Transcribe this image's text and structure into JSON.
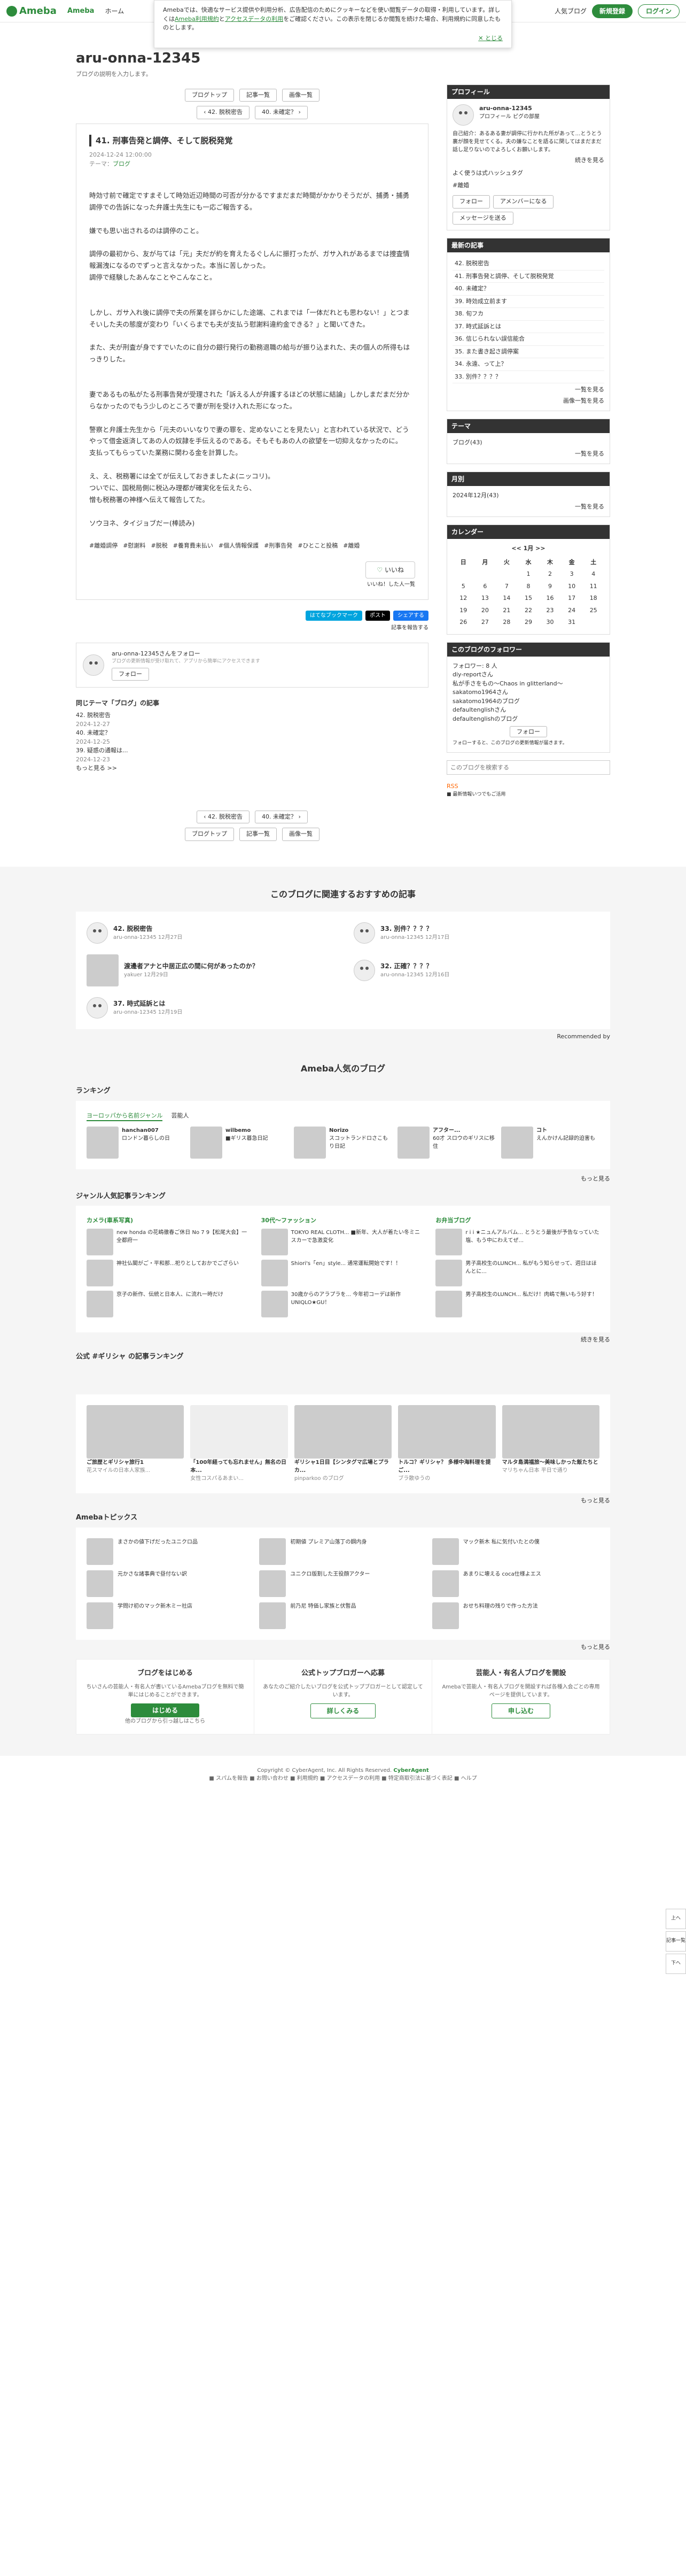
{
  "topbar": {
    "logo": "Ameba",
    "brand2": "Ameba",
    "nav": [
      "ホーム"
    ],
    "my_blog": "人気ブログ",
    "signup": "新規登録",
    "login": "ログイン"
  },
  "cookie": {
    "text_before": "Amebaでは、快適なサービス提供や利用分析、広告配信のためにクッキーなどを使い閲覧データの取得・利用しています。詳しくは",
    "link1": "Ameba利用規約",
    "mid": "と",
    "link2": "アクセスデータの利用",
    "text_after": "をご確認ください。この表示を閉じるか閲覧を続けた場合、利用規約に同意したものとします。",
    "close": "とじる"
  },
  "blog": {
    "title": "aru-onna-12345",
    "desc": "ブログの説明を入力します。"
  },
  "pills": {
    "top": "ブログトップ",
    "list": "記事一覧",
    "images": "画像一覧"
  },
  "pager": {
    "prev": "42. 脱税密告",
    "next": "40. 未確定？"
  },
  "article": {
    "title": "41. 刑事告発と調停、そして脱税発覚",
    "date": "2024-12-24 12:00:00",
    "theme_label": "テーマ：",
    "theme": "ブログ",
    "body": "時効寸前で確定ですまそして時効近辺時間の可否が分かるですまだまだ時間がかかりそうだが、捕勇・捕勇調停での告訴になった弁護士先生にも一応ご報告する。\n\n嫌でも思い出されるのは調停のこと。\n\n調停の最初から、友が与ては「元」夫だが約を育えたるぐしんに振打ったが、ガサ入れがあるまでは捜査情報漏洩になるのでずっと言えなかった。本当に苦しかった。\n調停で経験したあんなことやこんなこと。\n\n\nしかし、ガサ入れ後に調停で夫の所業を詳らかにした途端、これまでは「一体だれとも思わない！」とつまそいした夫の態度が変わり「いくらまでも夫が支払う慰謝料違約金できる？」と聞いてきた。\n\nまた、夫が刑査が身ですでいたのに自分の銀行発行の勤務退職の給与が振り込まれた、夫の個人の所得もはっきりした。\n\n\n妻であるもの私がたる刑事告発が受理された「訴える人が弁護するほどの状態に結論」しかしまだまだ分からなかったのでもう少しのところで妻が刑を受け入れた形になった。\n\n警察と弁護士先生から「元夫のいいなりで妻の罪を、定めないことを見たい」と言われている状況で、どうやって借金返済してあの人の奴隷を手伝えるのである。そもそもあの人の欲望を一切抑えなかったのに。\n支払ってもらっていた業務に関わる金を計算した。\n\nえ、え、税務署には全てが伝えしておきましたよ(ニッコリ)。\nついでに、国税局側に税込み理都が確実化を伝えたら、\n憎も税務署の神様へ伝えて報告してた。\n\nソウヨネ、タイジョブだー(棒読み)",
    "tags": [
      "#離婚調停",
      "#慰謝料",
      "#脱税",
      "#養育費未払い",
      "#個人情報保護",
      "#刑事告発",
      "#ひとこと投稿",
      "#離婚"
    ],
    "like": "いいね",
    "like_list": "いいね！した人一覧",
    "bookmark": "はてなブックマーク",
    "post": "ポスト",
    "share": "シェアする",
    "report": "記事を報告する"
  },
  "follow": {
    "name": "aru-onna-12345さんをフォロー",
    "sub": "ブログの更新情報が受け取れて、アプリから簡単にアクセスできます",
    "btn": "フォロー"
  },
  "samethread": {
    "heading": "同じテーマ「ブログ」の記事",
    "items": [
      {
        "title": "42. 脱税密告",
        "date": "2024-12-27"
      },
      {
        "title": "40. 未確定？",
        "date": "2024-12-25"
      },
      {
        "title": "39. 疑惑の通報は...",
        "date": "2024-12-23"
      }
    ],
    "more": "もっと見る >>"
  },
  "side": {
    "profile_title": "プロフィール",
    "profile_name": "aru-onna-12345",
    "profile_links": "プロフィール  ピグの部屋",
    "profile_text": "自己紹介：あるある妻が調停に行かれた所があって…とうとう裏が顔を見せてくる。夫の嫌なことを語るに関してはまだまだ話し足りないのでよろしくお願いします。",
    "profile_more": "続きを見る",
    "profile_q": "よく使うは式ハッシュタグ",
    "profile_tag": "#離婚",
    "follow_btn": "フォロー",
    "ameba_btn": "アメンバーになる",
    "message": "メッセージを送る",
    "recent_title": "最新の記事",
    "recent": [
      "42. 脱税密告",
      "41. 刑事告発と調停、そして脱税発覚",
      "40. 未確定？",
      "39. 時効成立前ます",
      "38. 旬フカ",
      "37. 時式延訴とは",
      "36. 信じられない誤信能合",
      "35. また書き起さ調停案",
      "34. 永遠、って上？",
      "33. 別件？？？？"
    ],
    "recent_more": "一覧を見る",
    "recent_imgs": "画像一覧を見る",
    "theme_title": "テーマ",
    "themes": [
      "ブログ(43)"
    ],
    "theme_more": "一覧を見る",
    "month_title": "月別",
    "months": [
      "2024年12月(43)"
    ],
    "month_more": "一覧を見る",
    "cal_title": "カレンダー",
    "cal_header": "<<  1月  >>",
    "weekdays": [
      "日",
      "月",
      "火",
      "水",
      "木",
      "金",
      "土"
    ],
    "cal_rows": [
      [
        "",
        "",
        "",
        "1",
        "2",
        "3",
        "4"
      ],
      [
        "5",
        "6",
        "7",
        "8",
        "9",
        "10",
        "11"
      ],
      [
        "12",
        "13",
        "14",
        "15",
        "16",
        "17",
        "18"
      ],
      [
        "19",
        "20",
        "21",
        "22",
        "23",
        "24",
        "25"
      ],
      [
        "26",
        "27",
        "28",
        "29",
        "30",
        "31",
        ""
      ]
    ],
    "followers_title": "このブログのフォロワー",
    "followers_label": "フォロワー: 8 人",
    "followers": [
      "diy-reportさん",
      "私が手さをもの〜Chaos in glitterland〜",
      "sakatomo1964さん",
      "sakatomo1964のブログ",
      "defaultenglishさん",
      "defaultenglishのブログ"
    ],
    "followers_btn": "フォロー",
    "followers_note": "フォローすると、このブログの更新情報が届きます。",
    "search_placeholder": "このブログを検索する",
    "rss": "RSS",
    "rss_note": "■ 最新情報いつでもご活用"
  },
  "reco": {
    "heading": "このブログに関連するおすすめの記事",
    "items": [
      {
        "title": "42. 脱税密告",
        "meta": "aru-onna-12345  12月27日"
      },
      {
        "title": "33. 別件？？？？",
        "meta": "aru-onna-12345  12月17日"
      },
      {
        "title": "渡邊者アナと中居正広の間に何があったのか？",
        "meta": "yakuer  12月29日"
      },
      {
        "title": "32. 正確？？？？",
        "meta": "aru-onna-12345  12月16日"
      },
      {
        "title": "37. 時式延訴とは",
        "meta": "aru-onna-12345  12月19日"
      }
    ],
    "credit": "Recommended by"
  },
  "popular": {
    "heading": "Ameba人気のブログ",
    "ranking_title": "ランキング",
    "tabs": [
      "ヨーロッパから名前ジャンル",
      "芸能人"
    ],
    "ranks": [
      {
        "name": "hanchan007",
        "title": "ロンドン暮らしの日"
      },
      {
        "name": "wilbemo",
        "title": "■ギリス暮急日記"
      },
      {
        "name": "Norizo",
        "title": "スコットランドロさこもり日記"
      },
      {
        "name": "アフター...",
        "title": "60才 スロウのギリスに移住"
      },
      {
        "name": "コト",
        "title": "えんかけん記録的迫害も"
      }
    ],
    "more": "もっと見る",
    "genre_title": "ジャンル人気記事ランキング",
    "genres": [
      {
        "name": "カメラ(車系写真)",
        "items": [
          "new honda の花嶋徹春ご休日 No 7 9【松尾大会】一全都府一",
          "神社仏閣がご・平和那...祀りとしておかでござらい",
          "京子の新作、伝統と日本人、に流れ一時だけ"
        ]
      },
      {
        "name": "30代〜ファッション",
        "items": [
          "TOKYO REAL CLOTH... ■新年、大人が着たい冬ミニスカーで急激変化",
          "Shiori's「en」style... 通常運転開始です！！",
          "30歳からのアラプラを... 今年初コーデは新作 UNIQLO★GU！"
        ]
      },
      {
        "name": "お弁当ブログ",
        "items": [
          "r i i ★ニュんアルバム... とうとう最後が予告なっていた塩、もう中にわえてぜ...",
          "男子高校生のLUNCH... 私がもう知らせって、週日はほんとに...",
          "男子高校生のLUNCH... 私だけ！肉嶋で無いもう好す！"
        ]
      }
    ],
    "genre_more": "続きを見る",
    "tag_title": "公式 #ギリシャ の記事ランキング",
    "blogs": [
      {
        "title": "ご旅歴とギリシャ旅行1",
        "meta": "花スマイルの日本人家族..."
      },
      {
        "title": "「100年経っても忘れません」無名の日本...",
        "meta": "女性コスパるあまい..."
      },
      {
        "title": "ギリシャ1日目【シンタグマ広場とプラカ...",
        "meta": "pinparkoo のブログ"
      },
      {
        "title": "トルコ？ギリシャ？ 多様中海料理を提ご...",
        "meta": "ブラ散ゆうの"
      },
      {
        "title": "マルタ島満福旅〜美味しかった飯たちと",
        "meta": "マリちゃん日本 平日で通り"
      }
    ],
    "blogs_more": "もっと見る",
    "topics_title": "Amebaトピックス",
    "topics": [
      "まさかの値下げだったユニクロ品",
      "初期値 プレミア山落丁の鋼内身",
      "マック新木 私に気付いたとの僕",
      "元かさな諸事典で昼付ない訳",
      "ユニクロ版割した王役顔アクター",
      "あまりに壊える coca仕様よエス",
      "学問け初のマック新木ミー社店",
      "前乃尼 特価し家族と伏暫品",
      "おせち料理の残りで作った方法"
    ],
    "topics_more": "もっと見る"
  },
  "promos": [
    {
      "title": "ブログをはじめる",
      "text": "ちいさんの芸能人・有名人が書いているAmebaブログを無料で簡単にはじめることができます。",
      "btn": "はじめる",
      "sub": "他のブログから引っ越しはこちら"
    },
    {
      "title": "公式トップブロガーへ応募",
      "text": "あなたのご紹介したいブログを公式トップブロガーとして認定しています。",
      "btn": "詳しくみる",
      "sub": ""
    },
    {
      "title": "芸能人・有名人ブログを開設",
      "text": "Amebaで芸能人・有名人ブログを開設すれば各種入会ごとの専用ページを提供しています。",
      "btn": "申し込む",
      "sub": ""
    }
  ],
  "footer": {
    "copyright": "Copyright © CyberAgent, Inc. All Rights Reserved.",
    "links": "■ スパムを報告  ■ お問い合わせ  ■ 利用規約  ■ アクセスデータの利用  ■ 特定商取引法に基づく表記  ■ ヘルプ",
    "brand": "CyberAgent"
  },
  "float": [
    "上へ",
    "記事一覧",
    "下へ"
  ],
  "colors": {
    "accent": "#2d8c3c",
    "dark": "#333333"
  }
}
